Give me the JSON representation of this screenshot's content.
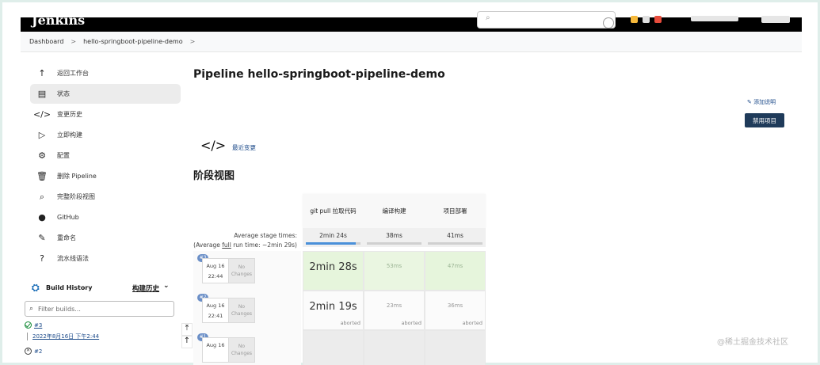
{
  "header": {
    "logo": "Jenkins"
  },
  "breadcrumb": {
    "items": [
      "Dashboard",
      "hello-springboot-pipeline-demo"
    ],
    "separator": ">"
  },
  "sidebar": {
    "items": [
      {
        "label": "返回工作台",
        "icon": "arrow-up-icon"
      },
      {
        "label": "状态",
        "icon": "document-icon",
        "active": true
      },
      {
        "label": "变更历史",
        "icon": "code-icon"
      },
      {
        "label": "立即构建",
        "icon": "play-icon"
      },
      {
        "label": "配置",
        "icon": "gear-icon"
      },
      {
        "label": "删除 Pipeline",
        "icon": "trash-icon"
      },
      {
        "label": "完整阶段视图",
        "icon": "search-icon"
      },
      {
        "label": "GitHub",
        "icon": "github-icon"
      },
      {
        "label": "重命名",
        "icon": "pencil-icon"
      },
      {
        "label": "流水线语法",
        "icon": "help-icon"
      }
    ]
  },
  "build_history": {
    "title": "Build History",
    "trend_label": "构建历史",
    "filter_placeholder": "Filter builds...",
    "entries": [
      {
        "number": "#3",
        "date": "2022年8月16日 下午2:44"
      },
      {
        "number": "#2"
      }
    ]
  },
  "main": {
    "title": "Pipeline hello-springboot-pipeline-demo",
    "add_description": "添加说明",
    "disable_button": "禁用项目",
    "recent_changes": "最近变更",
    "stage_view_title": "阶段视图"
  },
  "stage_view": {
    "stages": [
      "git pull 拉取代码",
      "编译构建",
      "项目部署"
    ],
    "avg_label_line1": "Average stage times:",
    "avg_label_line2_prefix": "(Average ",
    "avg_label_line2_link": "full",
    "avg_label_line2_suffix": " run time: ~2min 29s)",
    "avg_times": [
      "2min 24s",
      "38ms",
      "41ms"
    ],
    "avg_progress": [
      0.92,
      0.0,
      0.0
    ],
    "builds": [
      {
        "badge": "#3",
        "date": "Aug 16",
        "time": "22:44",
        "changes": "No Changes",
        "times": [
          "2min 28s",
          "53ms",
          "47ms"
        ],
        "status": [
          "success",
          "success",
          "success"
        ],
        "aborted_label": ""
      },
      {
        "badge": "#2",
        "date": "Aug 16",
        "time": "22:41",
        "changes": "No Changes",
        "times": [
          "2min 19s",
          "23ms",
          "36ms"
        ],
        "status": [
          "aborted",
          "aborted",
          "aborted"
        ],
        "aborted_label": "aborted"
      },
      {
        "badge": "#1",
        "date": "Aug 16",
        "time": "",
        "changes": "No Changes",
        "times": [
          "",
          "",
          ""
        ],
        "status": [
          "none",
          "none",
          "none"
        ],
        "aborted_label": ""
      }
    ]
  },
  "watermark": "@稀土掘金技术社区",
  "colors": {
    "header_bg": "#000000",
    "success_cell": "#e6f5dc",
    "button_bg": "#1f3b5a",
    "link": "#1d4b8a"
  }
}
